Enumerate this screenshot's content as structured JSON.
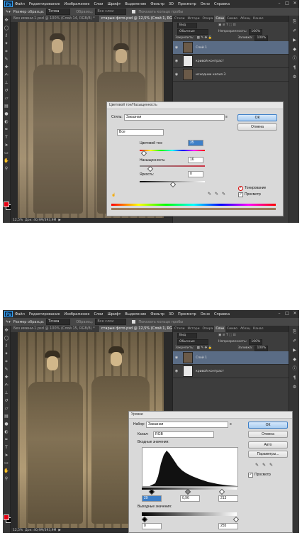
{
  "app": {
    "logo": "Ps",
    "menu": [
      "Файл",
      "Редактирование",
      "Изображение",
      "Слои",
      "Шрифт",
      "Выделение",
      "Фильтр",
      "3D",
      "Просмотр",
      "Окно",
      "Справка"
    ],
    "window_controls": [
      "–",
      "□",
      "✕"
    ]
  },
  "shot1": {
    "options_bar": {
      "sample_label": "Размер образца:",
      "sample_value": "Точка",
      "sample2_label": "Образец:",
      "sample2_value": "Все слои",
      "show_ring": "Показать кольцо пробы"
    },
    "tabs": [
      "Без имени-1.psd @ 100% (Слой 14, RGB/8) *",
      "старые фото.psd @ 12,5% (Слой 1, RGB/8) *"
    ],
    "status": {
      "zoom": "12,5%",
      "doc": "Док: 40,9М/393,9М"
    },
    "panel_tabs": [
      "Стили",
      "Истори",
      "Опера",
      "Слои",
      "Симво",
      "Абзац",
      "Канал"
    ],
    "panel_kind": "Вид",
    "blend_mode": "Обычные",
    "opacity_label": "Непрозрачность:",
    "opacity_value": "100%",
    "lock_label": "Закрепить:",
    "fill_label": "Заливка:",
    "fill_value": "100%",
    "layers": [
      "Слой 1",
      "кривой контраст",
      "исходник копия 3"
    ],
    "dialog": {
      "title": "Цветовой тон/Насыщенность",
      "style_label": "Стиль:",
      "style_value": "Заказная",
      "channel_value": "Все",
      "hue_label": "Цветовой тон:",
      "hue_value": "35",
      "sat_label": "Насыщенность:",
      "sat_value": "16",
      "light_label": "Яркость:",
      "light_value": "0",
      "ok": "ОК",
      "cancel": "Отмена",
      "colorize_label": "Тонирование",
      "preview_label": "Просмотр",
      "colorize_checked": true,
      "preview_checked": true
    }
  },
  "shot2": {
    "options_bar": {
      "sample_label": "Размер образца:",
      "sample_value": "Точка",
      "sample2_label": "Образец:",
      "sample2_value": "Все слои",
      "show_ring": "Показать кольцо пробы"
    },
    "tabs": [
      "Без имени-1.psd @ 100% (Слой 15, RGB/8) *",
      "старые фото.psd @ 12,5% (Слой 1, RGB/8) *"
    ],
    "status": {
      "zoom": "12,5%",
      "doc": "Док: 40,9М/393,9М"
    },
    "panel_tabs": [
      "Стили",
      "Истори",
      "Опера",
      "Слои",
      "Симво",
      "Абзац",
      "Канал"
    ],
    "panel_kind": "Вид",
    "blend_mode": "Обычные",
    "opacity_label": "Непрозрачность:",
    "opacity_value": "100%",
    "lock_label": "Закрепить:",
    "fill_label": "Заливка:",
    "fill_value": "100%",
    "layers": [
      "Слой 1",
      "кривой контраст"
    ],
    "dialog": {
      "title": "Уровни",
      "preset_label": "Набор:",
      "preset_value": "Заказная",
      "channel_label": "Канал:",
      "channel_value": "RGB",
      "input_label": "Входные значения:",
      "input_black": "29",
      "input_gamma": "0,96",
      "input_white": "213",
      "output_label": "Выходные значения:",
      "output_black": "0",
      "output_white": "255",
      "ok": "ОК",
      "cancel": "Отмена",
      "auto": "Авто",
      "params": "Параметры...",
      "preview_label": "Просмотр",
      "preview_checked": true
    }
  }
}
